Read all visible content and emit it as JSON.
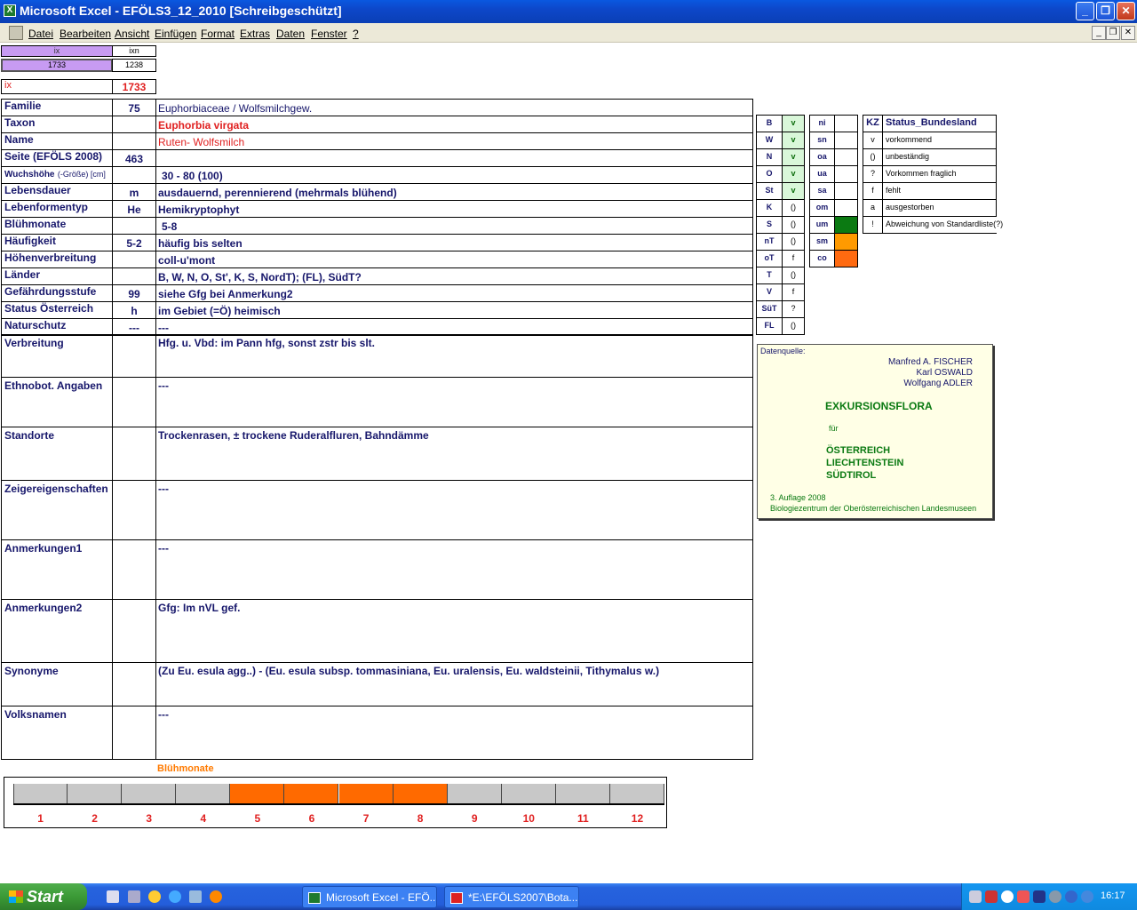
{
  "window": {
    "title": "Microsoft Excel - EFÖLS3_12_2010  [Schreibgeschützt]",
    "app_icon": "excel-icon"
  },
  "menu": [
    "Datei",
    "Bearbeiten",
    "Ansicht",
    "Einfügen",
    "Format",
    "Extras",
    "Daten",
    "Fenster",
    "?"
  ],
  "top": {
    "ix_header": "ix",
    "ixn_header": "ixn",
    "ix_value": "1733",
    "ixn_value": "1238",
    "ix_label": "ix",
    "ix_big": "1733"
  },
  "rows": [
    {
      "label": "Familie",
      "num": "75",
      "value": "Euphorbiaceae  /  Wolfsmilchgew."
    },
    {
      "label": "Taxon",
      "num": "",
      "value": "Euphorbia virgata"
    },
    {
      "label": "Name",
      "num": "",
      "value": "Ruten- Wolfsmilch"
    },
    {
      "label": "Seite (EFÖLS 2008)",
      "num": "463",
      "value": ""
    },
    {
      "label": "Wuchshöhe",
      "label_suffix": "(-Größe) [cm]",
      "num": "",
      "value": "30 - 80 (100)"
    },
    {
      "label": "Lebensdauer",
      "num": "m",
      "value": "ausdauernd, perennierend (mehrmals blühend)"
    },
    {
      "label": "Lebenformentyp",
      "num": "He",
      "value": "Hemikryptophyt"
    },
    {
      "label": "Blühmonate",
      "num": "",
      "value": "5-8"
    },
    {
      "label": "Häufigkeit",
      "num": "5-2",
      "value": "häufig bis selten"
    },
    {
      "label": "Höhenverbreitung",
      "num": "",
      "value": "coll-u'mont"
    },
    {
      "label": "Länder",
      "num": "",
      "value": "B, W, N, O, St', K, S, NordT); (FL), SüdT?"
    },
    {
      "label": "Gefährdungsstufe",
      "num": "99",
      "value": "siehe Gfg bei Anmerkung2"
    },
    {
      "label": "Status Österreich",
      "num": "h",
      "value": "im Gebiet (=Ö) heimisch"
    },
    {
      "label": "Naturschutz",
      "num": "---",
      "value": "---"
    }
  ],
  "tall_rows": [
    {
      "label": "Verbreitung",
      "value": "Hfg. u. Vbd: im Pann hfg, sonst zstr bis slt."
    },
    {
      "label": "Ethnobot. Angaben",
      "value": "---"
    },
    {
      "label": "Standorte",
      "value": "Trockenrasen, ± trockene Ruderalfluren, Bahndämme"
    },
    {
      "label": "Zeigereigenschaften",
      "value": "---"
    },
    {
      "label": "Anmerkungen1",
      "value": "---"
    },
    {
      "label": "Anmerkungen2",
      "value": "Gfg: Im nVL gef."
    },
    {
      "label": "Synonyme",
      "value": "(Zu Eu. esula agg..) - (Eu. esula subsp. tommasiniana, Eu. uralensis, Eu. waldsteinii, Tithymalus w.)"
    },
    {
      "label": "Volksnamen",
      "value": "---"
    }
  ],
  "laender": [
    {
      "code": "B",
      "val": "v"
    },
    {
      "code": "W",
      "val": "v"
    },
    {
      "code": "N",
      "val": "v"
    },
    {
      "code": "O",
      "val": "v"
    },
    {
      "code": "St",
      "val": "v"
    },
    {
      "code": "K",
      "val": "()"
    },
    {
      "code": "S",
      "val": "()"
    },
    {
      "code": "nT",
      "val": "()"
    },
    {
      "code": "oT",
      "val": "f"
    },
    {
      "code": "T",
      "val": "()"
    },
    {
      "code": "V",
      "val": "f"
    },
    {
      "code": "SüT",
      "val": "?"
    },
    {
      "code": "FL",
      "val": "()"
    }
  ],
  "hoehen": [
    {
      "code": "ni",
      "color": "#ffffff"
    },
    {
      "code": "sn",
      "color": "#ffffff"
    },
    {
      "code": "oa",
      "color": "#ffffff"
    },
    {
      "code": "ua",
      "color": "#ffffff"
    },
    {
      "code": "sa",
      "color": "#ffffff"
    },
    {
      "code": "om",
      "color": "#ffffff"
    },
    {
      "code": "um",
      "color": "#0b7a12"
    },
    {
      "code": "sm",
      "color": "#ff9a00"
    },
    {
      "code": "co",
      "color": "#ff6a10"
    }
  ],
  "status": {
    "kz_header": "KZ",
    "name_header": "Status_Bundesland",
    "items": [
      {
        "kz": "v",
        "text": "vorkommend"
      },
      {
        "kz": "()",
        "text": "unbeständig"
      },
      {
        "kz": "?",
        "text": "Vorkommen fraglich"
      },
      {
        "kz": "f",
        "text": "fehlt"
      },
      {
        "kz": "a",
        "text": "ausgestorben"
      },
      {
        "kz": "!",
        "text": "Abweichung von Standardliste(?)"
      }
    ]
  },
  "source": {
    "label": "Datenquelle:",
    "authors": [
      "Manfred A. FISCHER",
      "Karl OSWALD",
      "Wolfgang ADLER"
    ],
    "book": "EXKURSIONSFLORA",
    "fuer": "für",
    "countries": [
      "ÖSTERREICH",
      "LIECHTENSTEIN",
      "SÜDTIROL"
    ],
    "edition": "3. Auflage 2008",
    "publisher": "Biologiezentrum der Oberösterreichischen Landesmuseen"
  },
  "bluete": {
    "title": "Blühmonate",
    "months": [
      "1",
      "2",
      "3",
      "4",
      "5",
      "6",
      "7",
      "8",
      "9",
      "10",
      "11",
      "12"
    ],
    "active": [
      5,
      6,
      7,
      8
    ],
    "active_color": "#ff6a00",
    "inactive_color": "#c8c8c8"
  },
  "taskbar": {
    "start": "Start",
    "tasks": [
      "Microsoft Excel - EFÖ...",
      "*E:\\EFÖLS2007\\Bota..."
    ],
    "clock": "16:17"
  }
}
